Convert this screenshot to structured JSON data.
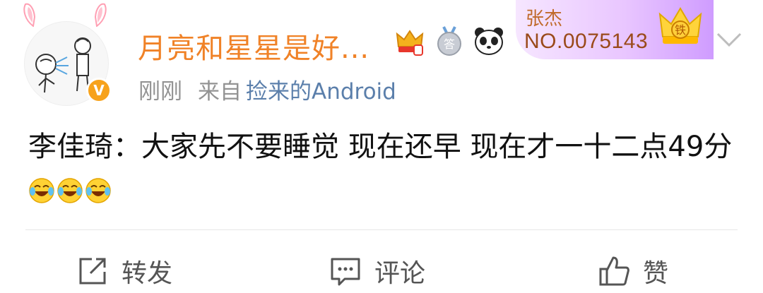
{
  "post": {
    "username": "月亮和星星是好...",
    "fan_badge": {
      "name": "张杰",
      "number": "NO.0075143",
      "crown_label": "铁"
    },
    "meta": {
      "time": "刚刚",
      "from_label": "来自",
      "source": "捡来的Android"
    },
    "content": "李佳琦：大家先不要睡觉 现在还早 现在才一十二点49分",
    "verified_label": "V",
    "icons": {
      "avatar": "avatar-cartoon",
      "crown_badge": "crown-icon",
      "answer_badge": "answer-medal-icon",
      "panda_badge": "panda-icon",
      "more": "chevron-down-icon",
      "repost": "repost-icon",
      "comment": "comment-icon",
      "like": "thumbs-up-icon",
      "emoji": "laugh-cry-emoji"
    },
    "colors": {
      "username": "#f08227",
      "source_link": "#5b7fab",
      "meta_text": "#939393",
      "verified": "#f7a21b"
    }
  },
  "actions": {
    "repost_label": "转发",
    "comment_label": "评论",
    "like_label": "赞"
  }
}
